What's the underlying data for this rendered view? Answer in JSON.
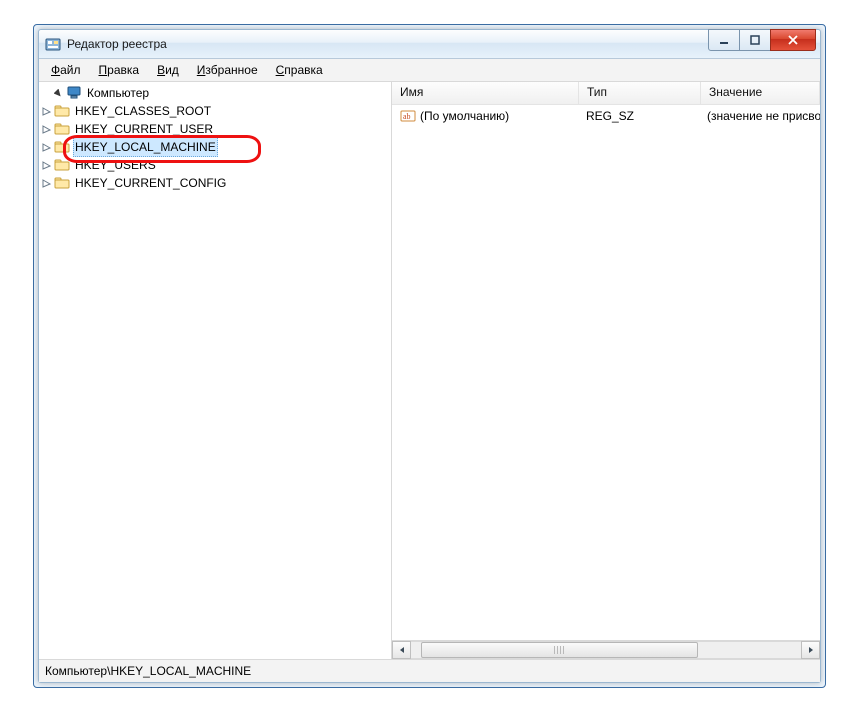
{
  "window": {
    "title": "Редактор реестра"
  },
  "menubar": {
    "file": "Файл",
    "edit": "Правка",
    "view": "Вид",
    "favorites": "Избранное",
    "help": "Справка"
  },
  "tree": {
    "root": "Компьютер",
    "keys": [
      "HKEY_CLASSES_ROOT",
      "HKEY_CURRENT_USER",
      "HKEY_LOCAL_MACHINE",
      "HKEY_USERS",
      "HKEY_CURRENT_CONFIG"
    ],
    "selected_index": 2,
    "highlighted_index": 2
  },
  "list": {
    "columns": {
      "name": "Имя",
      "type": "Тип",
      "value": "Значение"
    },
    "rows": [
      {
        "name": "(По умолчанию)",
        "type": "REG_SZ",
        "value": "(значение не присво"
      }
    ]
  },
  "statusbar": {
    "path": "Компьютер\\HKEY_LOCAL_MACHINE"
  },
  "icons": {
    "app": "regedit-icon",
    "computer": "computer-icon",
    "folder": "folder-icon",
    "string_value": "ab-string-icon"
  }
}
